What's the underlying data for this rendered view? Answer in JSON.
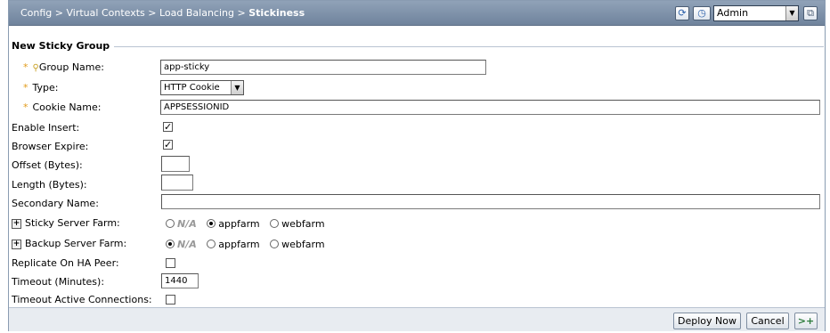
{
  "header": {
    "breadcrumb_path": "Config > Virtual Contexts > Load Balancing > ",
    "breadcrumb_current": "Stickiness",
    "refresh_icon": "refresh-icon",
    "history_icon": "clock-icon",
    "context_select": "Admin",
    "window_icon": "external-window-icon"
  },
  "form": {
    "legend": "New Sticky Group",
    "group_name": {
      "label": "Group Name:",
      "value": "app-sticky"
    },
    "type": {
      "label": "Type:",
      "value": "HTTP Cookie"
    },
    "cookie_name": {
      "label": "Cookie Name:",
      "value": "APPSESSIONID"
    },
    "enable_insert": {
      "label": "Enable Insert:",
      "checked": true
    },
    "browser_expire": {
      "label": "Browser Expire:",
      "checked": true
    },
    "offset": {
      "label": "Offset (Bytes):",
      "value": ""
    },
    "length": {
      "label": "Length (Bytes):",
      "value": ""
    },
    "secondary_name": {
      "label": "Secondary Name:",
      "value": ""
    },
    "sticky_server_farm": {
      "label": "Sticky Server Farm:",
      "options": [
        "N/A",
        "appfarm",
        "webfarm"
      ],
      "selected": "appfarm"
    },
    "backup_server_farm": {
      "label": "Backup Server Farm:",
      "options": [
        "N/A",
        "appfarm",
        "webfarm"
      ],
      "selected": "N/A"
    },
    "replicate_ha": {
      "label": "Replicate On HA Peer:",
      "checked": false
    },
    "timeout": {
      "label": "Timeout (Minutes):",
      "value": "1440"
    },
    "timeout_active": {
      "label": "Timeout Active Connections:",
      "checked": false
    }
  },
  "footer": {
    "deploy_label": "Deploy Now",
    "cancel_label": "Cancel",
    "next_label": ">+"
  },
  "colors": {
    "titlebar": "#7d90a8",
    "required_star": "#e29b1a",
    "footer_bg": "#e8ecf1"
  }
}
